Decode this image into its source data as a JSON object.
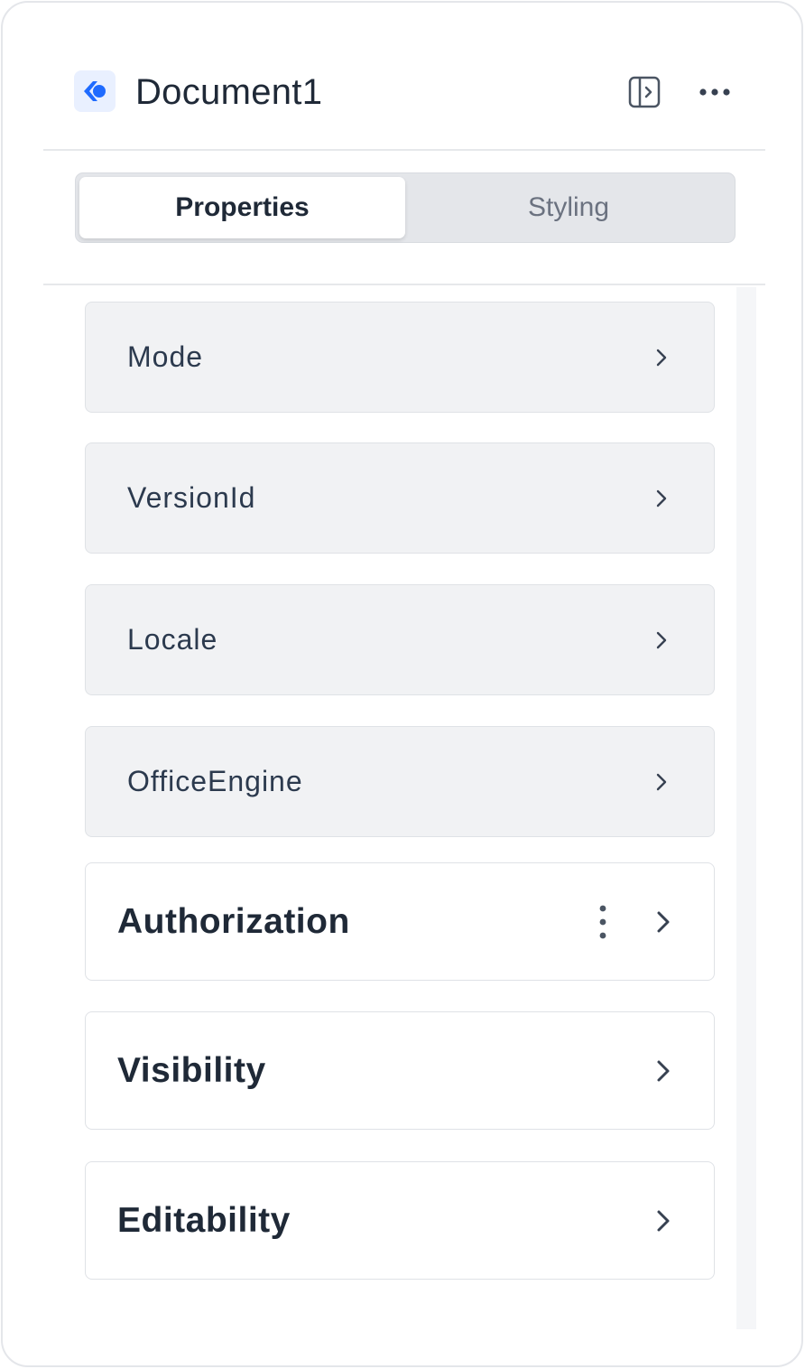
{
  "header": {
    "title": "Document1",
    "logo_icon": "app-logo-icon",
    "panel_toggle_icon": "panel-toggle-icon",
    "more_icon": "more-horizontal-icon"
  },
  "tabs": [
    {
      "label": "Properties",
      "active": true
    },
    {
      "label": "Styling",
      "active": false
    }
  ],
  "sections": [
    {
      "label": "Mode",
      "style": "collapsed-gray"
    },
    {
      "label": "VersionId",
      "style": "collapsed-gray"
    },
    {
      "label": "Locale",
      "style": "collapsed-gray"
    },
    {
      "label": "OfficeEngine",
      "style": "collapsed-gray"
    },
    {
      "label": "Authorization",
      "style": "group",
      "has_menu": true
    },
    {
      "label": "Visibility",
      "style": "group"
    },
    {
      "label": "Editability",
      "style": "group"
    }
  ],
  "colors": {
    "accent": "#2563eb",
    "text": "#1f2937",
    "muted": "#6b7280",
    "border": "#dfe2e6"
  }
}
